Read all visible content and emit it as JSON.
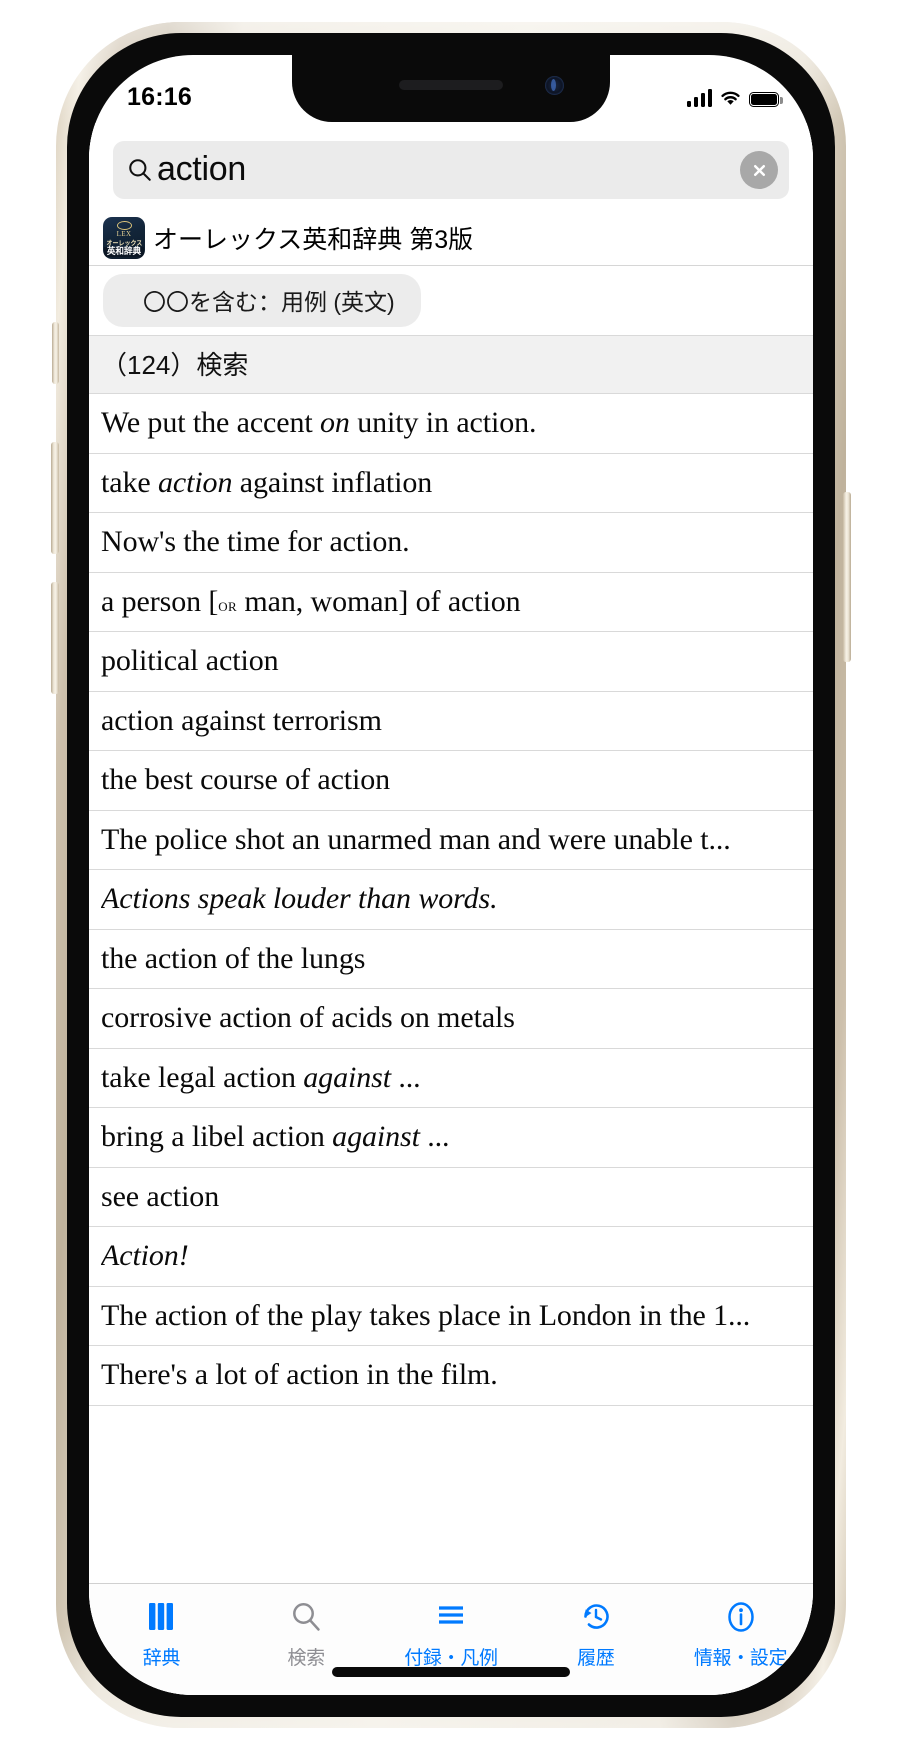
{
  "status_bar": {
    "time": "16:16",
    "signal_icon": "cellular-bars-icon",
    "wifi_icon": "wifi-icon",
    "battery_icon": "battery-full-icon"
  },
  "search": {
    "value": "action",
    "placeholder": "",
    "search_icon": "search-icon",
    "clear_icon": "clear-circle-icon"
  },
  "dictionary": {
    "title": "オーレックス英和辞典 第3版",
    "icon_ring": "",
    "icon_lex": "LEX",
    "icon_jp_top": "オーレックス",
    "icon_jp_bottom": "英和辞典"
  },
  "filter": {
    "chip_label": "〇〇を含む：用例 (英文)"
  },
  "section": {
    "header": "（124）検索",
    "count": 124
  },
  "results": [
    {
      "parts": [
        {
          "t": "We put the accent ",
          "s": "n"
        },
        {
          "t": "on",
          "s": "i"
        },
        {
          "t": " unity in action.",
          "s": "n"
        }
      ]
    },
    {
      "parts": [
        {
          "t": "take ",
          "s": "n"
        },
        {
          "t": "action",
          "s": "i"
        },
        {
          "t": " against inflation",
          "s": "n"
        }
      ]
    },
    {
      "parts": [
        {
          "t": "Now's the time for action.",
          "s": "n"
        }
      ]
    },
    {
      "parts": [
        {
          "t": "a person [",
          "s": "n"
        },
        {
          "t": "or",
          "s": "sc"
        },
        {
          "t": " man, woman] of action",
          "s": "n"
        }
      ]
    },
    {
      "parts": [
        {
          "t": "political action",
          "s": "n"
        }
      ]
    },
    {
      "parts": [
        {
          "t": "action against terrorism",
          "s": "n"
        }
      ]
    },
    {
      "parts": [
        {
          "t": "the best course of action",
          "s": "n"
        }
      ]
    },
    {
      "parts": [
        {
          "t": "The police shot an unarmed man and were unable t...",
          "s": "n"
        }
      ]
    },
    {
      "parts": [
        {
          "t": "Actions speak louder than words.",
          "s": "i"
        }
      ]
    },
    {
      "parts": [
        {
          "t": "the action of the lungs",
          "s": "n"
        }
      ]
    },
    {
      "parts": [
        {
          "t": "corrosive action of acids on metals",
          "s": "n"
        }
      ]
    },
    {
      "parts": [
        {
          "t": "take legal action ",
          "s": "n"
        },
        {
          "t": "against",
          "s": "i"
        },
        {
          "t": " ...",
          "s": "n"
        }
      ]
    },
    {
      "parts": [
        {
          "t": "bring a libel action ",
          "s": "n"
        },
        {
          "t": "against",
          "s": "i"
        },
        {
          "t": " ...",
          "s": "n"
        }
      ]
    },
    {
      "parts": [
        {
          "t": "see action",
          "s": "n"
        }
      ]
    },
    {
      "parts": [
        {
          "t": "Action!",
          "s": "i"
        }
      ]
    },
    {
      "parts": [
        {
          "t": "The action of the play takes place in London in the 1...",
          "s": "n"
        }
      ]
    },
    {
      "parts": [
        {
          "t": "There's a lot of action in the film.",
          "s": "n"
        }
      ]
    }
  ],
  "tabbar": {
    "items": [
      {
        "label": "辞典",
        "icon": "books-icon",
        "state": "active"
      },
      {
        "label": "検索",
        "icon": "search-icon",
        "state": "inactive"
      },
      {
        "label": "付録・凡例",
        "icon": "list-lines-icon",
        "state": "active"
      },
      {
        "label": "履歴",
        "icon": "history-clock-icon",
        "state": "active"
      },
      {
        "label": "情報・設定",
        "icon": "info-circle-icon",
        "state": "active"
      }
    ]
  },
  "colors": {
    "accent": "#007aff",
    "inactive": "#8e8e93",
    "search_bg": "#ebebeb",
    "chip_bg": "#ececec",
    "section_bg": "#f1f1f1",
    "separator": "#d9d9d9"
  }
}
